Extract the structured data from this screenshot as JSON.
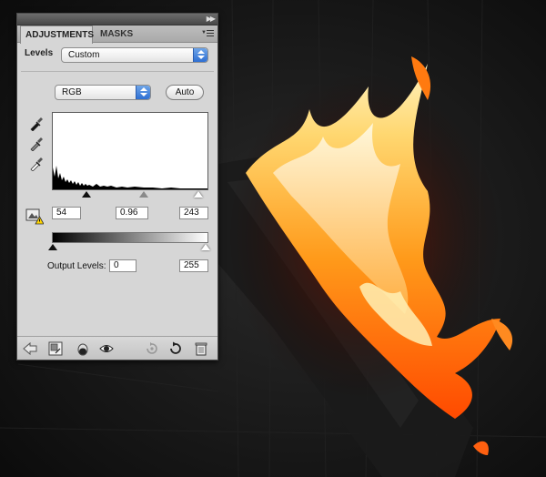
{
  "panel": {
    "tabs": [
      {
        "label": "ADJUSTMENTS",
        "active": true
      },
      {
        "label": "MASKS",
        "active": false
      }
    ],
    "collapse_icon": "double-chevron-right-icon",
    "menu_icon": "panel-menu-icon"
  },
  "levels": {
    "label": "Levels",
    "preset": "Custom",
    "channel": "RGB",
    "auto_label": "Auto",
    "input": {
      "black": "54",
      "gamma": "0.96",
      "white": "243"
    },
    "output": {
      "label": "Output Levels:",
      "black": "0",
      "white": "255"
    },
    "eyedroppers": [
      "black-point-eyedropper-icon",
      "gray-point-eyedropper-icon",
      "white-point-eyedropper-icon"
    ]
  },
  "toolbar": {
    "buttons": [
      "back-arrow-icon",
      "clip-to-layer-icon",
      "layer-visibility-toggle-icon",
      "eye-icon",
      "view-previous-state-icon",
      "reset-icon",
      "trash-icon"
    ]
  },
  "colors": {
    "panel_bg": "#d6d6d6",
    "select_accent": "#2e6fd3",
    "canvas_bg": "#151515",
    "flame_core": "#ffe48a",
    "flame_outer": "#ff5a00"
  }
}
